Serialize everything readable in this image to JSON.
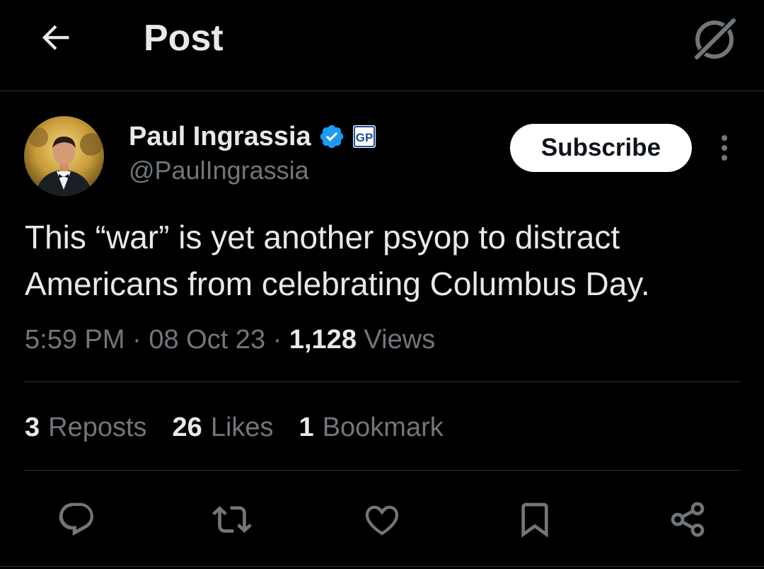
{
  "header": {
    "title": "Post",
    "back_icon": "arrow-left-icon",
    "grok_icon": "grok-icon"
  },
  "author": {
    "name": "Paul Ingrassia",
    "handle": "@PaulIngrassia",
    "verified_icon": "verified-badge-icon",
    "affiliation_badge": "GP",
    "subscribe_label": "Subscribe",
    "more_icon": "more-vertical-icon"
  },
  "post": {
    "text_lines": [
      "This “war” is yet another psyop to distract",
      "Americans from celebrating Columbus Day."
    ],
    "time": "5:59 PM",
    "sep1": " · ",
    "date": "08 Oct 23",
    "sep2": " · ",
    "views_count": "1,128",
    "views_label": "Views"
  },
  "stats": {
    "reposts_count": "3",
    "reposts_label": "Reposts",
    "likes_count": "26",
    "likes_label": "Likes",
    "bookmarks_count": "1",
    "bookmarks_label": "Bookmark"
  },
  "actions": [
    "reply-icon",
    "repost-icon",
    "like-icon",
    "bookmark-icon",
    "share-icon"
  ],
  "colors": {
    "background": "#000000",
    "text": "#e7e9ea",
    "secondary": "#71767b",
    "divider": "#2f3336",
    "verified": "#1d9bf0"
  }
}
